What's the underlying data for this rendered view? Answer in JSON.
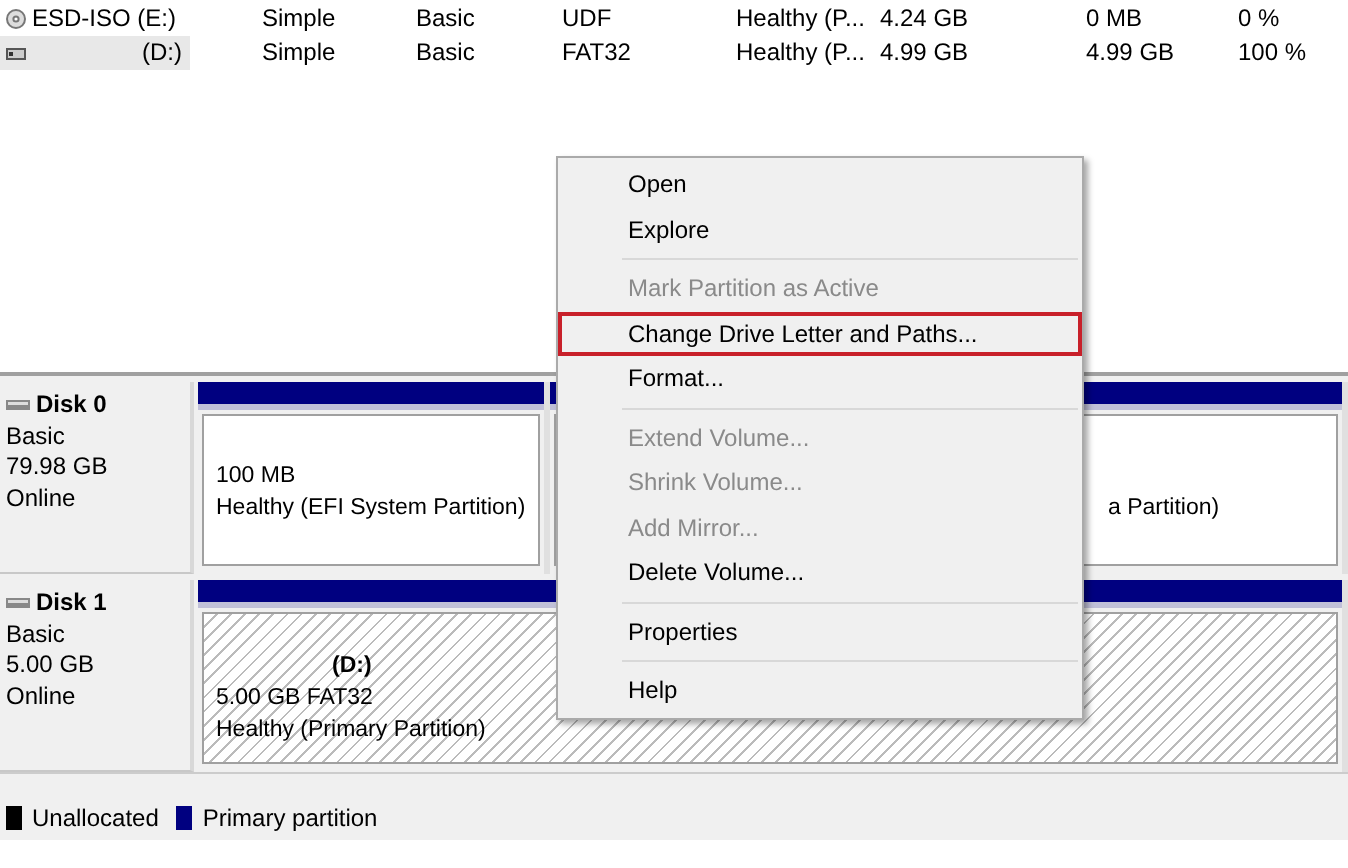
{
  "volumes": [
    {
      "kind": "disc",
      "name": "ESD-ISO (E:)",
      "layout": "Simple",
      "type": "Basic",
      "file_system": "UDF",
      "status": "Healthy (P...",
      "capacity": "4.24 GB",
      "free_space": "0 MB",
      "percent_free": "0 %",
      "selected": false
    },
    {
      "kind": "drive",
      "name": "(D:)",
      "layout": "Simple",
      "type": "Basic",
      "file_system": "FAT32",
      "status": "Healthy (P...",
      "capacity": "4.99 GB",
      "free_space": "4.99 GB",
      "percent_free": "100 %",
      "selected": true
    }
  ],
  "disks": [
    {
      "name": "Disk 0",
      "type": "Basic",
      "size": "79.98 GB",
      "state": "Online",
      "partitions": [
        {
          "size": "100 MB",
          "status": "Healthy (EFI System Partition)",
          "selected": false
        },
        {
          "status": "a Partition)",
          "selected": false
        }
      ]
    },
    {
      "name": "Disk 1",
      "type": "Basic",
      "size": "5.00 GB",
      "state": "Online",
      "partitions": [
        {
          "label": "(D:)",
          "size": "5.00 GB FAT32",
          "status": "Healthy (Primary Partition)",
          "selected": true
        }
      ]
    }
  ],
  "legend": [
    {
      "label": "Unallocated",
      "color": "#000000"
    },
    {
      "label": "Primary partition",
      "color": "#000080"
    }
  ],
  "context_menu": {
    "groups": [
      [
        {
          "label": "Open",
          "disabled": false,
          "highlighted": false
        },
        {
          "label": "Explore",
          "disabled": false,
          "highlighted": false
        }
      ],
      [
        {
          "label": "Mark Partition as Active",
          "disabled": true,
          "highlighted": false
        },
        {
          "label": "Change Drive Letter and Paths...",
          "disabled": false,
          "highlighted": true
        },
        {
          "label": "Format...",
          "disabled": false,
          "highlighted": false
        }
      ],
      [
        {
          "label": "Extend Volume...",
          "disabled": true,
          "highlighted": false
        },
        {
          "label": "Shrink Volume...",
          "disabled": true,
          "highlighted": false
        },
        {
          "label": "Add Mirror...",
          "disabled": true,
          "highlighted": false
        },
        {
          "label": "Delete Volume...",
          "disabled": false,
          "highlighted": false
        }
      ],
      [
        {
          "label": "Properties",
          "disabled": false,
          "highlighted": false
        }
      ],
      [
        {
          "label": "Help",
          "disabled": false,
          "highlighted": false
        }
      ]
    ]
  }
}
